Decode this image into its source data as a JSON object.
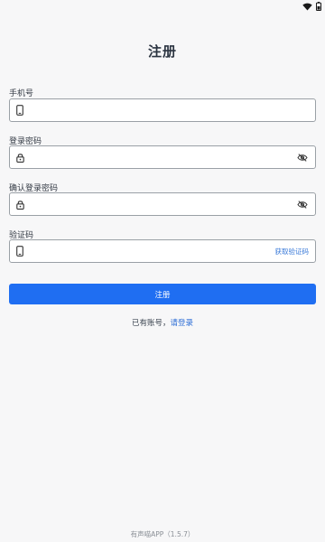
{
  "status_bar": {
    "icons": [
      "wifi-icon",
      "battery-icon"
    ]
  },
  "page": {
    "title": "注册"
  },
  "form": {
    "phone": {
      "label": "手机号",
      "placeholder": "",
      "icon": "phone-icon"
    },
    "password": {
      "label": "登录密码",
      "placeholder": "",
      "icon": "lock-icon",
      "toggle_icon": "eye-off-icon"
    },
    "confirm_password": {
      "label": "确认登录密码",
      "placeholder": "",
      "icon": "lock-icon",
      "toggle_icon": "eye-off-icon"
    },
    "verification_code": {
      "label": "验证码",
      "placeholder": "",
      "icon": "phone-icon",
      "get_code_label": "获取验证码"
    },
    "submit_label": "注册"
  },
  "login_prompt": {
    "text": "已有账号，",
    "link_label": "请登录"
  },
  "footer": {
    "app_version": "有声喵APP（1.5.7）"
  },
  "colors": {
    "accent": "#1f6ef2",
    "link": "#2f6fd6",
    "background": "#f7f7f8",
    "border": "#9aa0a6"
  }
}
